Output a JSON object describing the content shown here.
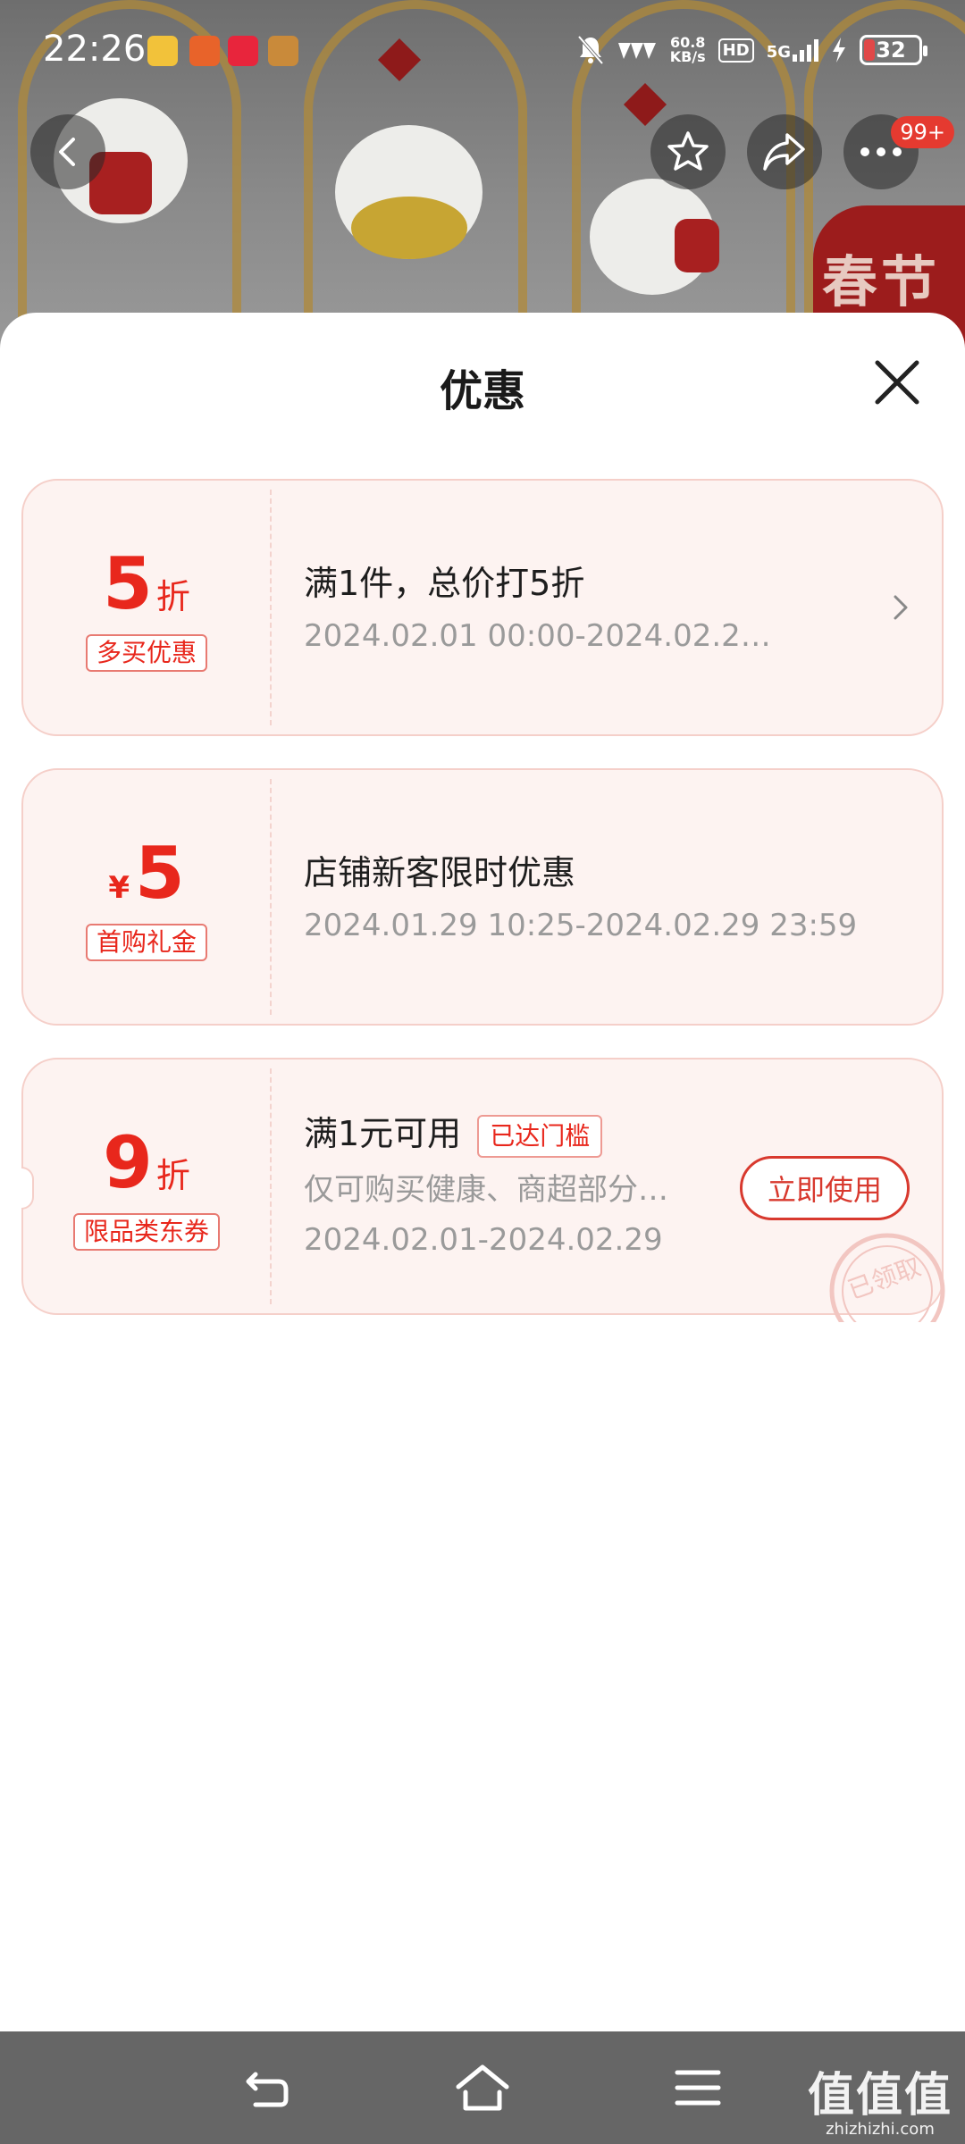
{
  "status_bar": {
    "time": "22:26",
    "net_speed_value": "60.8",
    "net_speed_unit": "KB/s",
    "hd_label": "HD",
    "network_label": "5G",
    "battery_level": "32"
  },
  "header": {
    "back_icon": "chevron-left-icon",
    "favorite_icon": "star-icon",
    "share_icon": "share-icon",
    "more_icon": "more-dots-icon",
    "more_badge": "99+"
  },
  "background": {
    "banner_text": "春节"
  },
  "sheet": {
    "title": "优惠",
    "close_icon": "close-icon"
  },
  "coupons": [
    {
      "amount": "5",
      "unit": "折",
      "tag": "多买优惠",
      "title": "满1件，总价打5折",
      "subtitle": "2024.02.01 00:00-2024.02.2…"
    },
    {
      "currency": "¥",
      "amount": "5",
      "tag": "首购礼金",
      "title": "店铺新客限时优惠",
      "subtitle": "2024.01.29 10:25-2024.02.29 23:59"
    },
    {
      "amount": "9",
      "unit": "折",
      "tag": "限品类东券",
      "title": "满1元可用",
      "threshold_tag": "已达门槛",
      "description": "仅可购买健康、商超部分…",
      "subtitle": "2024.02.01-2024.02.29",
      "action_label": "立即使用",
      "stamp_text": "已领取"
    }
  ],
  "nav_bar": {
    "back_icon": "nav-back-icon",
    "home_icon": "nav-home-icon",
    "menu_icon": "nav-menu-icon"
  },
  "watermark": {
    "main": "值值值",
    "sub": "zhizhizhi.com"
  },
  "colors": {
    "accent": "#e8271c",
    "coupon_bg": "#fdf3f1",
    "coupon_border": "#f5cfc9",
    "nav_bar": "#666666"
  }
}
